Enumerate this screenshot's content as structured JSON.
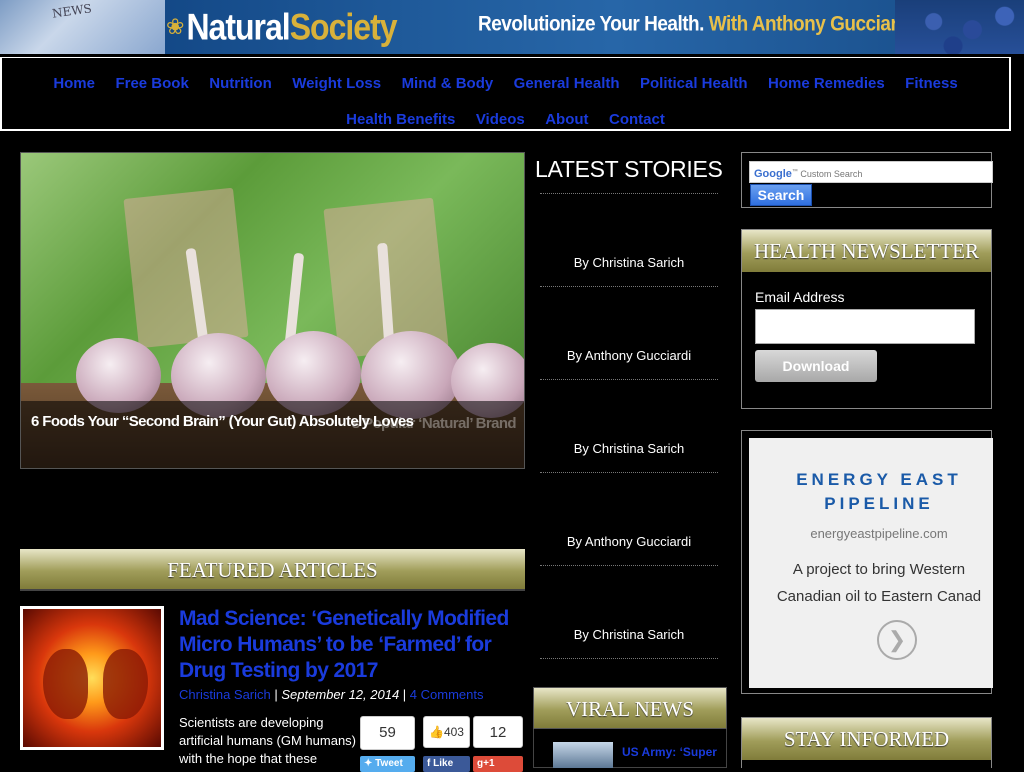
{
  "banner": {
    "news_label": "NEWS",
    "logo_natural": "Natural",
    "logo_society": "Society",
    "tagline_a": "Revolutionize Your Health.",
    "tagline_b": "With Anthony Gucciardi."
  },
  "nav": {
    "items": [
      "Home",
      "Free Book",
      "Nutrition",
      "Weight Loss",
      "Mind & Body",
      "General Health",
      "Political Health",
      "Home Remedies",
      "Fitness",
      "Health Benefits",
      "Videos",
      "About",
      "Contact"
    ]
  },
  "slider": {
    "caption": "6 Foods Your “Second Brain” (Your Gut) Absolutely Loves",
    "caption_faded": "s Popular ‘Natural’ Brand"
  },
  "featured": {
    "title": "FEATURED ARTICLES",
    "article": {
      "headline": "Mad Science: ‘Genetically Modified Micro Humans’ to be ‘Farmed’ for Drug Testing by 2017",
      "author": "Christina Sarich",
      "sep1": " | ",
      "date": "September 12, 2014",
      "sep2": " | ",
      "comments": "4 Comments",
      "excerpt": "Scientists are developing artificial humans (GM humans) with the hope that these",
      "tweet_count": "59",
      "tweet_label": "Tweet",
      "like_count": "403",
      "like_label": "Like",
      "gplus_count": "12",
      "gplus_label": "+1"
    }
  },
  "latest": {
    "title": "LATEST STORIES",
    "bylines": [
      "By Christina Sarich",
      "By Anthony Gucciardi",
      "By Christina Sarich",
      "By Anthony Gucciardi",
      "By Christina Sarich"
    ]
  },
  "viral": {
    "title": "VIRAL NEWS",
    "item": "US Army: ‘Super"
  },
  "search": {
    "brand": "Google",
    "placeholder": "Custom Search",
    "button": "Search"
  },
  "newsletter": {
    "title": "HEALTH NEWSLETTER",
    "label": "Email Address",
    "button": "Download"
  },
  "ad": {
    "title_1": "ENERGY EAST",
    "title_2": "PIPELINE",
    "url": "energyeastpipeline.com",
    "desc_1": "A project to bring Western",
    "desc_2": "Canadian oil to Eastern Canad",
    "arrow": "❯"
  },
  "stay": {
    "title": "STAY INFORMED"
  }
}
